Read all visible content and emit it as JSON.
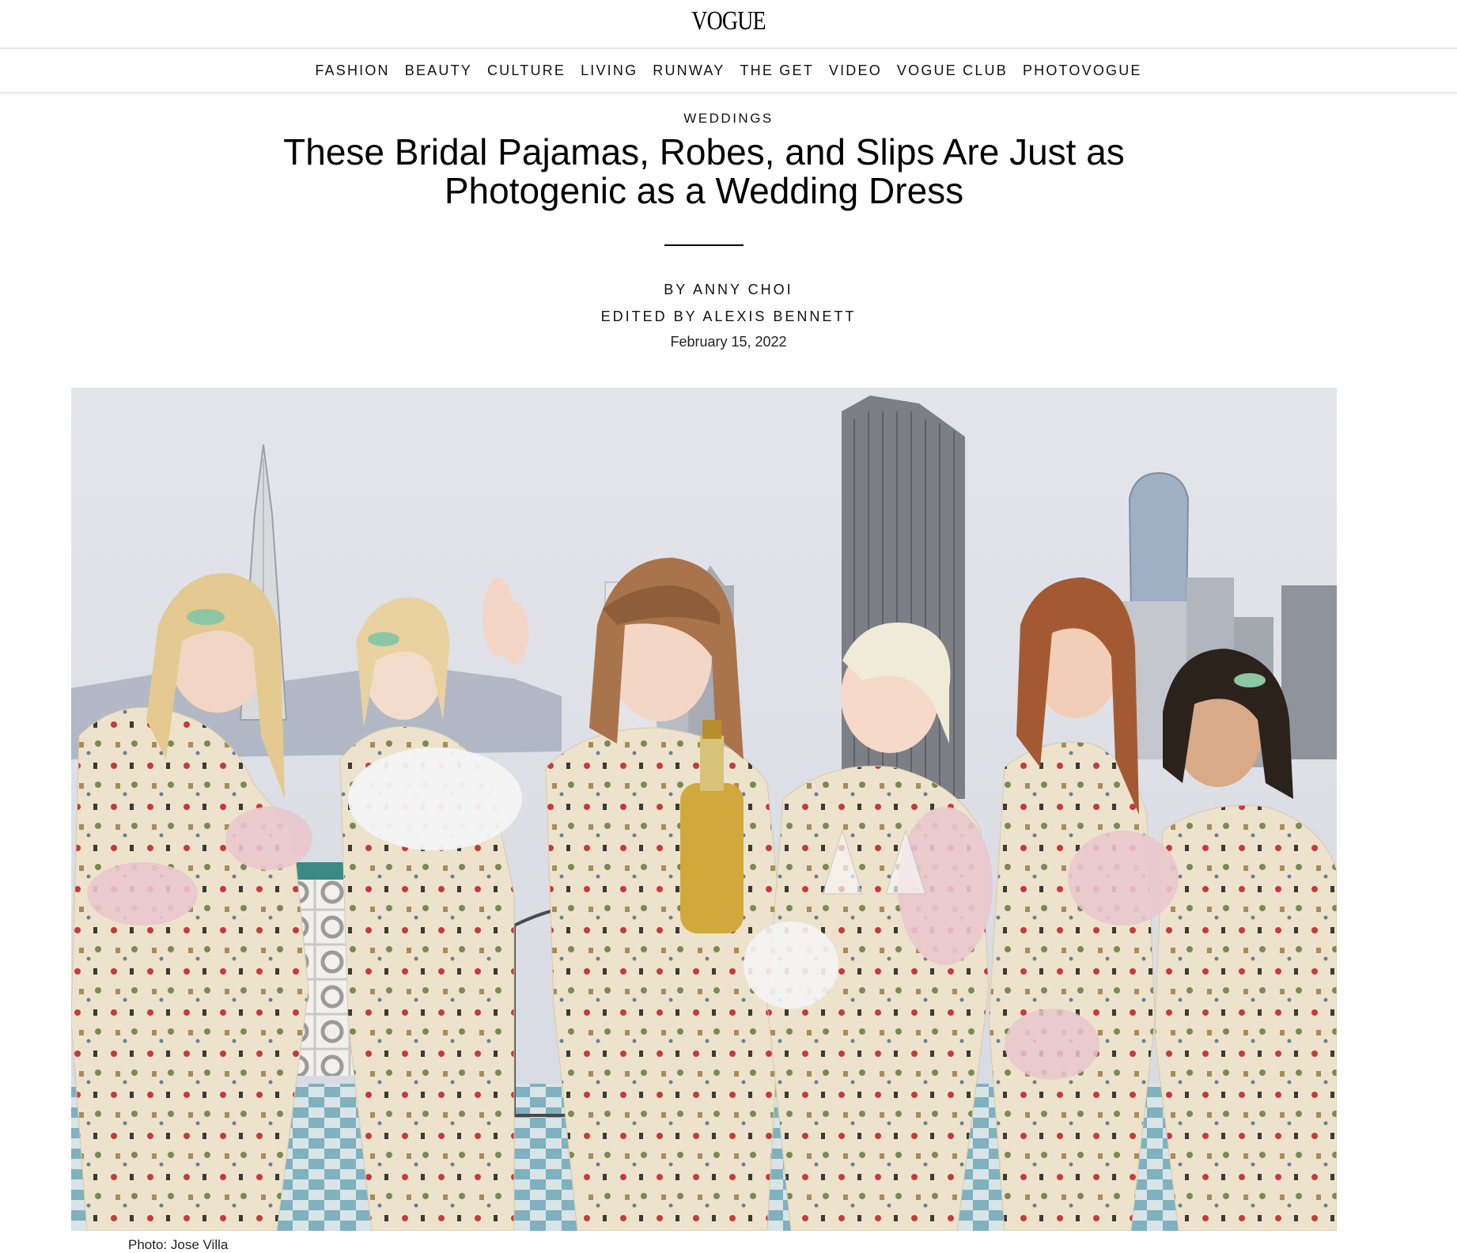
{
  "site": {
    "logo": "VOGUE"
  },
  "nav": {
    "items": [
      "FASHION",
      "BEAUTY",
      "CULTURE",
      "LIVING",
      "RUNWAY",
      "THE GET",
      "VIDEO",
      "VOGUE CLUB",
      "PHOTOVOGUE"
    ]
  },
  "article": {
    "rubric": "WEDDINGS",
    "headline": "These Bridal Pajamas, Robes, and Slips Are Just as Photogenic as a Wedding Dress",
    "author": "BY ANNY CHOI",
    "editor": "EDITED BY ALEXIS BENNETT",
    "date": "February 15, 2022",
    "photo_credit": "Photo: Jose Villa"
  },
  "colors": {
    "text": "#000000",
    "sky": "#dfe1e8",
    "pajama": "#ede3cc",
    "feather_pink": "#e9c7cc",
    "feather_white": "#f4f4f6"
  }
}
